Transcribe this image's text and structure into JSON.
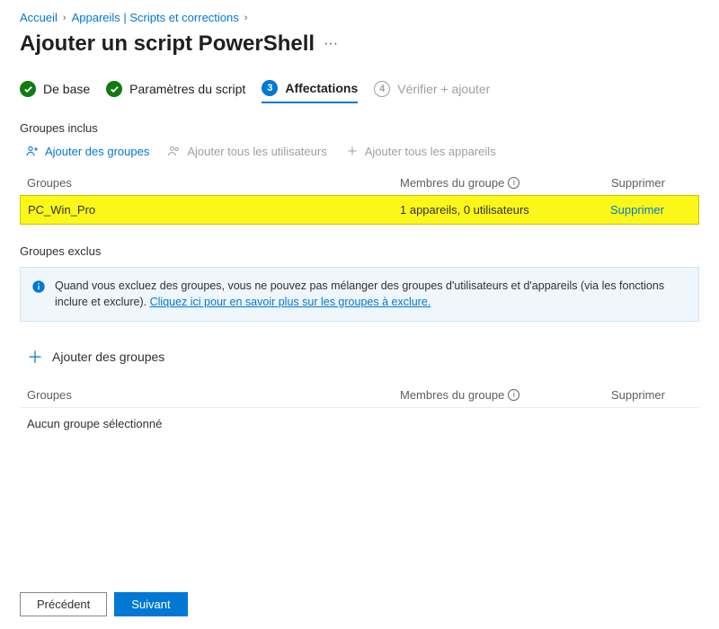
{
  "breadcrumb": {
    "home": "Accueil",
    "devices": "Appareils | Scripts et corrections"
  },
  "page": {
    "title": "Ajouter un script PowerShell"
  },
  "stepper": {
    "basics": "De base",
    "script": "Paramètres du script",
    "assign_num": "3",
    "assign": "Affectations",
    "review_num": "4",
    "review": "Vérifier + ajouter"
  },
  "included": {
    "title": "Groupes inclus",
    "add_groups": "Ajouter des groupes",
    "add_all_users": "Ajouter tous les utilisateurs",
    "add_all_devices": "Ajouter tous les appareils",
    "col_groups": "Groupes",
    "col_members": "Membres du groupe",
    "col_remove": "Supprimer",
    "rows": [
      {
        "name": "PC_Win_Pro",
        "members": "1 appareils, 0 utilisateurs",
        "remove": "Supprimer"
      }
    ]
  },
  "excluded": {
    "title": "Groupes exclus",
    "info_text": "Quand vous excluez des groupes, vous ne pouvez pas mélanger des groupes d'utilisateurs et d'appareils (via les fonctions inclure et exclure). ",
    "info_link": "Cliquez ici pour en savoir plus sur les groupes à exclure.",
    "add_groups": "Ajouter des groupes",
    "col_groups": "Groupes",
    "col_members": "Membres du groupe",
    "col_remove": "Supprimer",
    "none": "Aucun groupe sélectionné"
  },
  "footer": {
    "prev": "Précédent",
    "next": "Suivant"
  }
}
